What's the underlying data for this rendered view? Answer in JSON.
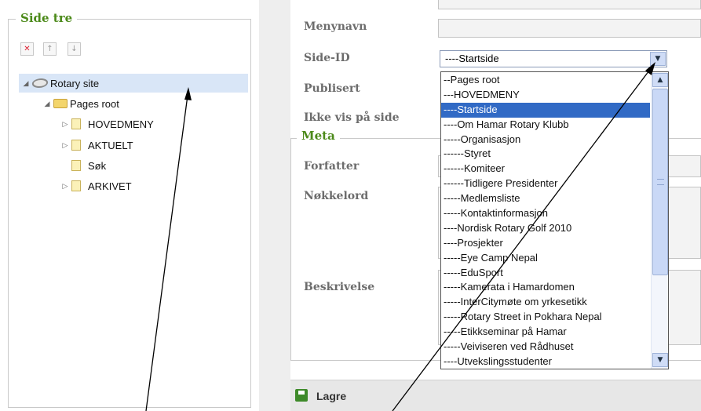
{
  "side_tree": {
    "legend": "Side tre",
    "toolbar": [
      "delete-icon",
      "move-up-icon",
      "move-down-icon"
    ],
    "root": "Rotary site",
    "pages_root": "Pages root",
    "children": [
      "HOVEDMENY",
      "AKTUELT",
      "Søk",
      "ARKIVET"
    ]
  },
  "form": {
    "menynavn_label": "Menynavn",
    "side_id_label": "Side-ID",
    "side_id_value": "----Startside",
    "publisert_label": "Publisert",
    "ikke_vis_label": "Ikke vis på side",
    "meta_legend": "Meta",
    "forfatter_label": "Forfatter",
    "nokkelord_label": "Nøkkelord",
    "beskrivelse_label": "Beskrivelse"
  },
  "dropdown": {
    "selected_index": 2,
    "options": [
      "--Pages root",
      "---HOVEDMENY",
      "----Startside",
      "----Om Hamar Rotary Klubb",
      "-----Organisasjon",
      "------Styret",
      "------Komiteer",
      "------Tidligere Presidenter",
      "-----Medlemsliste",
      "-----Kontaktinformasjon",
      "----Nordisk Rotary Golf 2010",
      "----Prosjekter",
      "-----Eye Camp Nepal",
      "-----EduSport",
      "-----Kamerata i Hamardomen",
      "-----InterCitymøte om yrkesetikk",
      "-----Rotary Street in Pokhara Nepal",
      "-----Etikkseminar på Hamar",
      "-----Veiviseren ved Rådhuset",
      "----Utvekslingsstudenter"
    ]
  },
  "save_bar": {
    "label": "Lagre"
  },
  "colors": {
    "legend_green": "#4c8a1a",
    "selection_blue": "#316ac5",
    "tree_highlight": "#d9e6f7"
  }
}
